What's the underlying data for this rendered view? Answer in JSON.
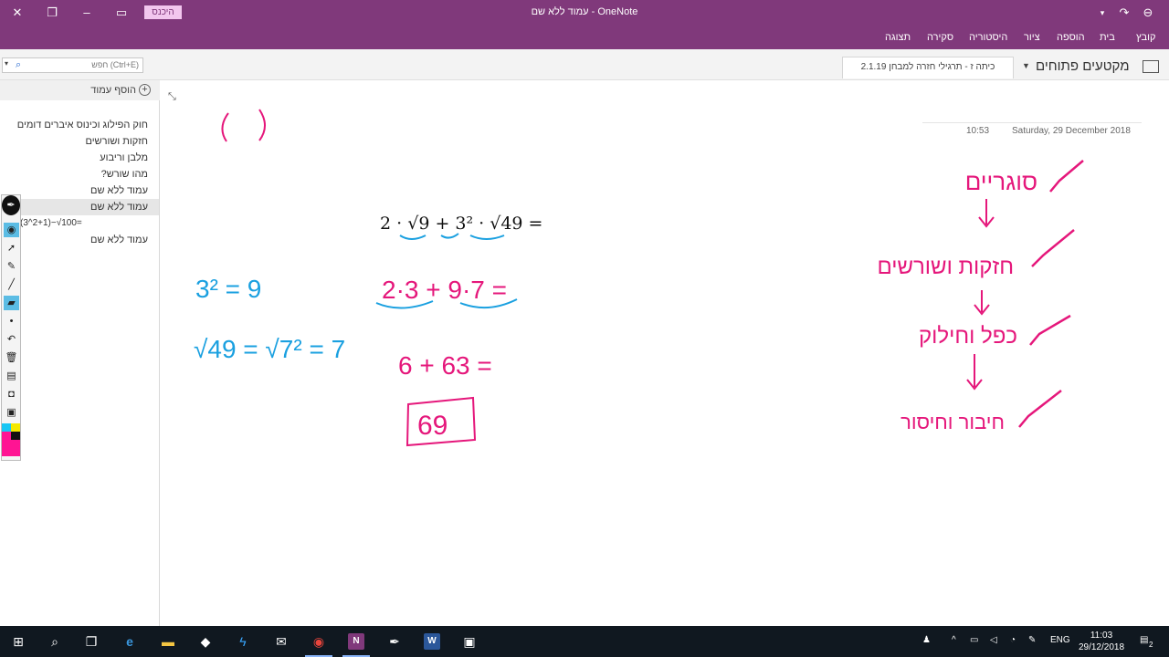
{
  "window": {
    "title": "עמוד ללא שם  -  OneNote",
    "signin_label": "היכנס"
  },
  "ribbon": {
    "tabs": [
      "קובץ",
      "בית",
      "הוספה",
      "ציור",
      "היסטוריה",
      "סקירה",
      "תצוגה"
    ]
  },
  "navbar": {
    "search_placeholder": "חפש (Ctrl+E)",
    "section_tab": "כיתה ז - תרגילי חזרה למבחן 2.1.19",
    "notebook_title": "מקטעים פתוחים"
  },
  "pagelist": {
    "add_page_label": "הוסף עמוד",
    "pages": [
      "חוק הפילוג וכינוס איברים דומים",
      "חזקות ושורשים",
      "מלבן וריבוע",
      "מהו שורש?",
      "עמוד ללא שם",
      "עמוד ללא שם",
      "(3^2+1)−√100=",
      "עמוד ללא שם"
    ]
  },
  "page": {
    "date": "Saturday, 29 December 2018",
    "time": "10:53",
    "exercise": "2 · √9 + 3² · √49 =",
    "step1": "2·3 + 9·7 =",
    "step2": "6 + 63 =",
    "answer": "69",
    "note_power": "3² = 9",
    "note_root": "√49 = √7² = 7",
    "order_steps": [
      "סוגריים",
      "חזקות ושורשים",
      "כפל וחילוק",
      "חיבור וחיסור"
    ]
  },
  "taskbar": {
    "lang": "ENG",
    "time": "11:03",
    "date": "29/12/2018",
    "notifications": "2"
  },
  "colors": {
    "onenote_purple": "#80397b",
    "ink_magenta": "#e5177b",
    "ink_blue": "#1aa0e0"
  }
}
